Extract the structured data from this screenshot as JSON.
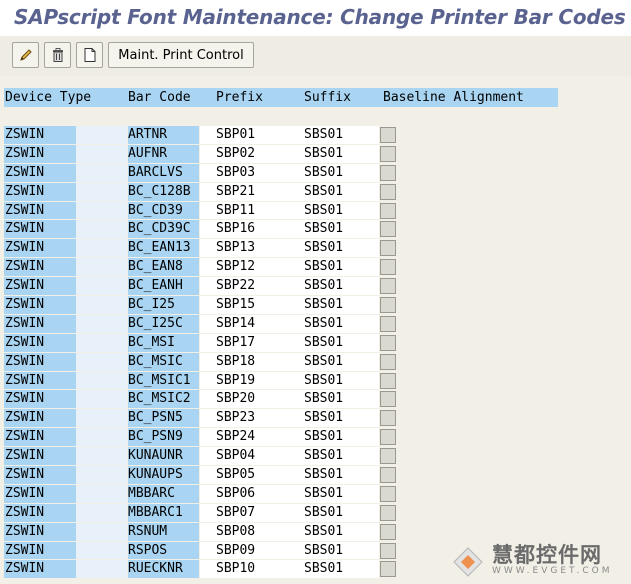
{
  "title": "SAPscript Font Maintenance: Change Printer Bar Codes",
  "toolbar": {
    "edit_icon": "pencil-icon",
    "delete_icon": "trash-icon",
    "new_icon": "new-document-icon",
    "maint_button": "Maint. Print Control"
  },
  "table": {
    "headers": {
      "device_type": "Device Type",
      "bar_code": "Bar Code",
      "prefix": "Prefix",
      "suffix": "Suffix",
      "baseline": "Baseline Alignment"
    },
    "rows": [
      {
        "device": "ZSWIN",
        "bar": "ARTNR",
        "prefix": "SBP01",
        "suffix": "SBS01"
      },
      {
        "device": "ZSWIN",
        "bar": "AUFNR",
        "prefix": "SBP02",
        "suffix": "SBS01"
      },
      {
        "device": "ZSWIN",
        "bar": "BARCLVS",
        "prefix": "SBP03",
        "suffix": "SBS01"
      },
      {
        "device": "ZSWIN",
        "bar": "BC_C128B",
        "prefix": "SBP21",
        "suffix": "SBS01"
      },
      {
        "device": "ZSWIN",
        "bar": "BC_CD39",
        "prefix": "SBP11",
        "suffix": "SBS01"
      },
      {
        "device": "ZSWIN",
        "bar": "BC_CD39C",
        "prefix": "SBP16",
        "suffix": "SBS01"
      },
      {
        "device": "ZSWIN",
        "bar": "BC_EAN13",
        "prefix": "SBP13",
        "suffix": "SBS01"
      },
      {
        "device": "ZSWIN",
        "bar": "BC_EAN8",
        "prefix": "SBP12",
        "suffix": "SBS01"
      },
      {
        "device": "ZSWIN",
        "bar": "BC_EANH",
        "prefix": "SBP22",
        "suffix": "SBS01"
      },
      {
        "device": "ZSWIN",
        "bar": "BC_I25",
        "prefix": "SBP15",
        "suffix": "SBS01"
      },
      {
        "device": "ZSWIN",
        "bar": "BC_I25C",
        "prefix": "SBP14",
        "suffix": "SBS01"
      },
      {
        "device": "ZSWIN",
        "bar": "BC_MSI",
        "prefix": "SBP17",
        "suffix": "SBS01"
      },
      {
        "device": "ZSWIN",
        "bar": "BC_MSIC",
        "prefix": "SBP18",
        "suffix": "SBS01"
      },
      {
        "device": "ZSWIN",
        "bar": "BC_MSIC1",
        "prefix": "SBP19",
        "suffix": "SBS01"
      },
      {
        "device": "ZSWIN",
        "bar": "BC_MSIC2",
        "prefix": "SBP20",
        "suffix": "SBS01"
      },
      {
        "device": "ZSWIN",
        "bar": "BC_PSN5",
        "prefix": "SBP23",
        "suffix": "SBS01"
      },
      {
        "device": "ZSWIN",
        "bar": "BC_PSN9",
        "prefix": "SBP24",
        "suffix": "SBS01"
      },
      {
        "device": "ZSWIN",
        "bar": "KUNAUNR",
        "prefix": "SBP04",
        "suffix": "SBS01"
      },
      {
        "device": "ZSWIN",
        "bar": "KUNAUPS",
        "prefix": "SBP05",
        "suffix": "SBS01"
      },
      {
        "device": "ZSWIN",
        "bar": "MBBARC",
        "prefix": "SBP06",
        "suffix": "SBS01"
      },
      {
        "device": "ZSWIN",
        "bar": "MBBARC1",
        "prefix": "SBP07",
        "suffix": "SBS01"
      },
      {
        "device": "ZSWIN",
        "bar": "RSNUM",
        "prefix": "SBP08",
        "suffix": "SBS01"
      },
      {
        "device": "ZSWIN",
        "bar": "RSPOS",
        "prefix": "SBP09",
        "suffix": "SBS01"
      },
      {
        "device": "ZSWIN",
        "bar": "RUECKNR",
        "prefix": "SBP10",
        "suffix": "SBS01"
      }
    ]
  },
  "watermark": {
    "text_cn": "慧都控件网",
    "text_en": "WWW.EVGET.COM",
    "logo_icon": "watermark-logo-icon"
  }
}
